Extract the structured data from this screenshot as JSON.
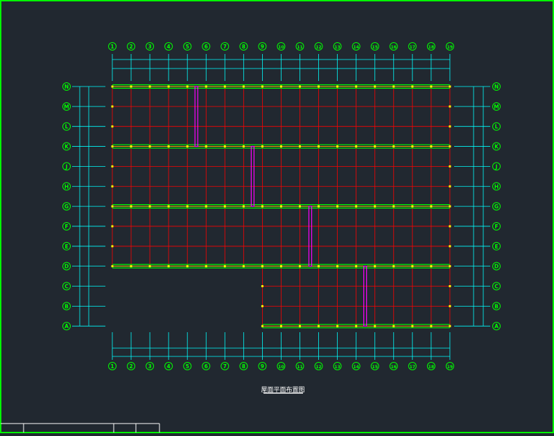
{
  "drawing": {
    "title": "屋面平面布置图",
    "colors": {
      "background": "#212830",
      "border": "#00ff00",
      "grid": "#ff0000",
      "dimension": "#00ffff",
      "bubble": "#00ff00",
      "beam": "#00ff00",
      "purlin": "#ffff00",
      "bracing": "#ff00ff",
      "title_block": "#ffffff",
      "node": "#ffff00"
    },
    "column_axes": [
      "1",
      "2",
      "3",
      "4",
      "5",
      "6",
      "7",
      "8",
      "9",
      "10",
      "11",
      "12",
      "13",
      "14",
      "15",
      "16",
      "17",
      "18",
      "19"
    ],
    "row_axes": [
      "N",
      "M",
      "L",
      "K",
      "J",
      "H",
      "G",
      "F",
      "E",
      "D",
      "C",
      "B",
      "A"
    ]
  }
}
